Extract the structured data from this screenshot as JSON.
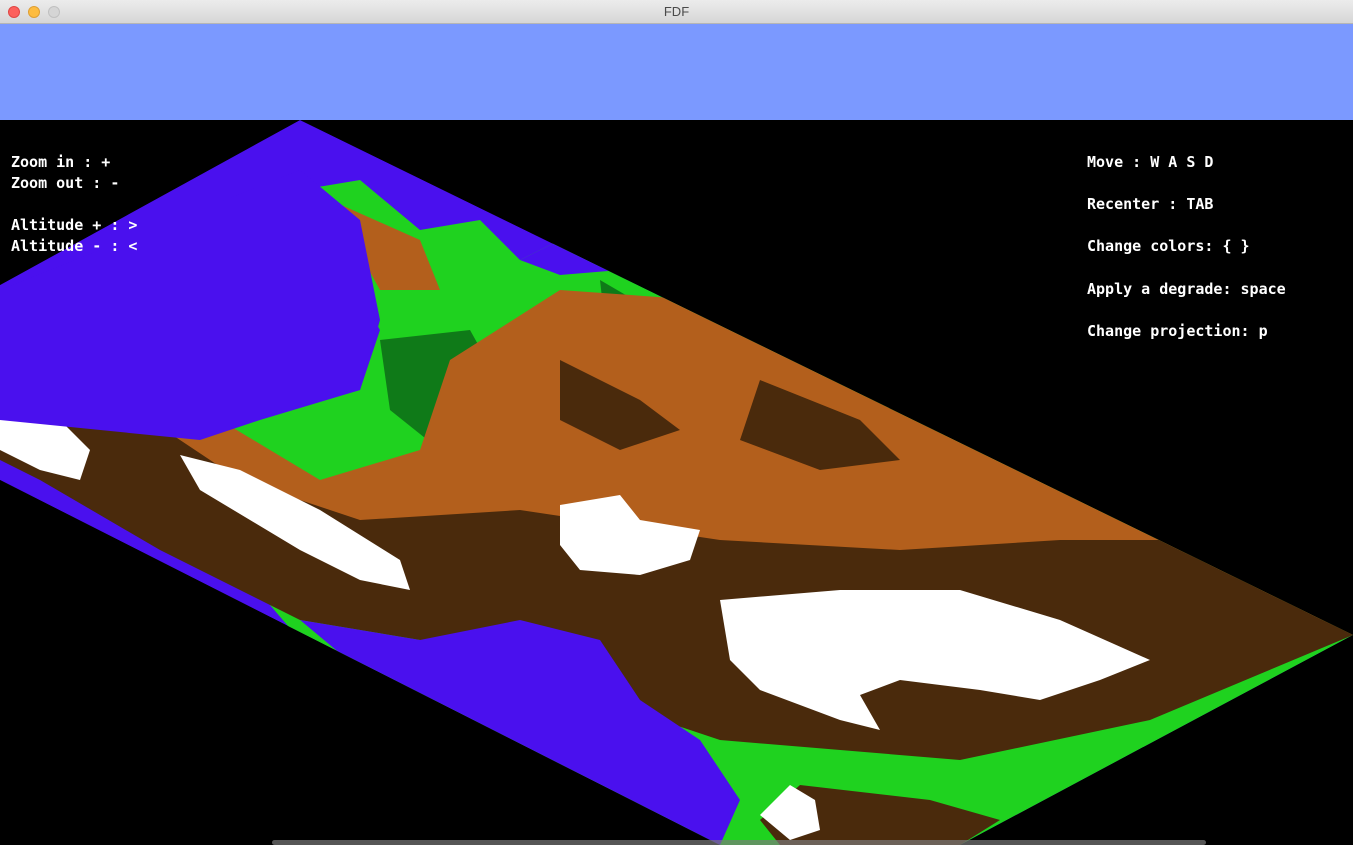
{
  "window": {
    "title": "FDF",
    "top_band_color": "#7b99ff",
    "background_color": "#000000"
  },
  "traffic_lights": [
    "close-button",
    "minimize-button",
    "zoom-button"
  ],
  "hud_left": {
    "zoom_in": "Zoom in : +",
    "zoom_out": "Zoom out : -",
    "altitude_up": "Altitude + : >",
    "altitude_down": "Altitude - : <"
  },
  "hud_right": {
    "move": "Move : W A S D",
    "recenter": "Recenter : TAB",
    "change_colors": "Change colors: { }",
    "degrade": "Apply a degrade: space",
    "projection": "Change projection: p"
  },
  "terrain_colors": {
    "water": "#4a10ee",
    "lowland": "#1fd21f",
    "forest": "#0f7a18",
    "plain": "#b35f1c",
    "mountain": "#4a2a0c",
    "snow": "#ffffff"
  }
}
